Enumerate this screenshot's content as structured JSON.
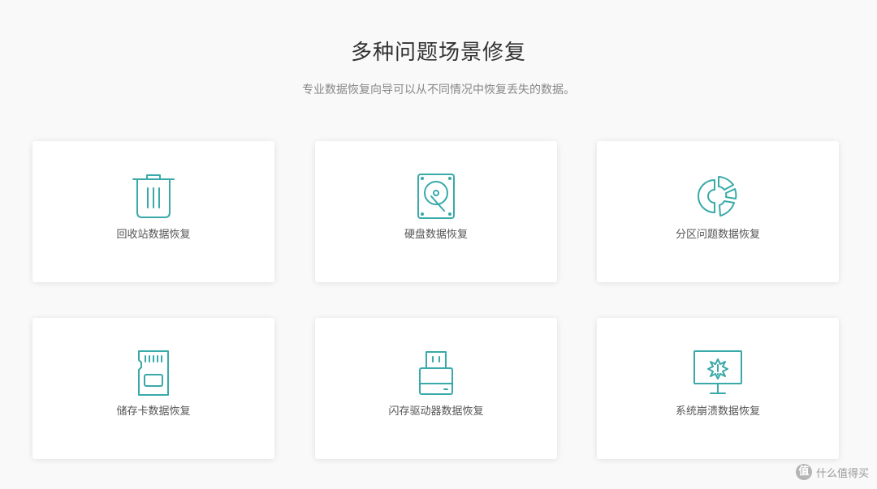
{
  "header": {
    "title": "多种问题场景修复",
    "subtitle": "专业数据恢复向导可以从不同情况中恢复丢失的数据。"
  },
  "theme": {
    "accent": "#3aa9a9",
    "card_bg": "#ffffff",
    "page_bg": "#f9f9f9"
  },
  "scenarios": [
    {
      "label": "回收站数据恢复",
      "icon": "trash-icon"
    },
    {
      "label": "硬盘数据恢复",
      "icon": "hard-disk-icon"
    },
    {
      "label": "分区问题数据恢复",
      "icon": "partition-icon"
    },
    {
      "label": "储存卡数据恢复",
      "icon": "memory-card-icon"
    },
    {
      "label": "闪存驱动器数据恢复",
      "icon": "usb-drive-icon"
    },
    {
      "label": "系统崩溃数据恢复",
      "icon": "system-crash-icon"
    }
  ],
  "watermark": {
    "badge": "值",
    "text": "什么值得买"
  }
}
